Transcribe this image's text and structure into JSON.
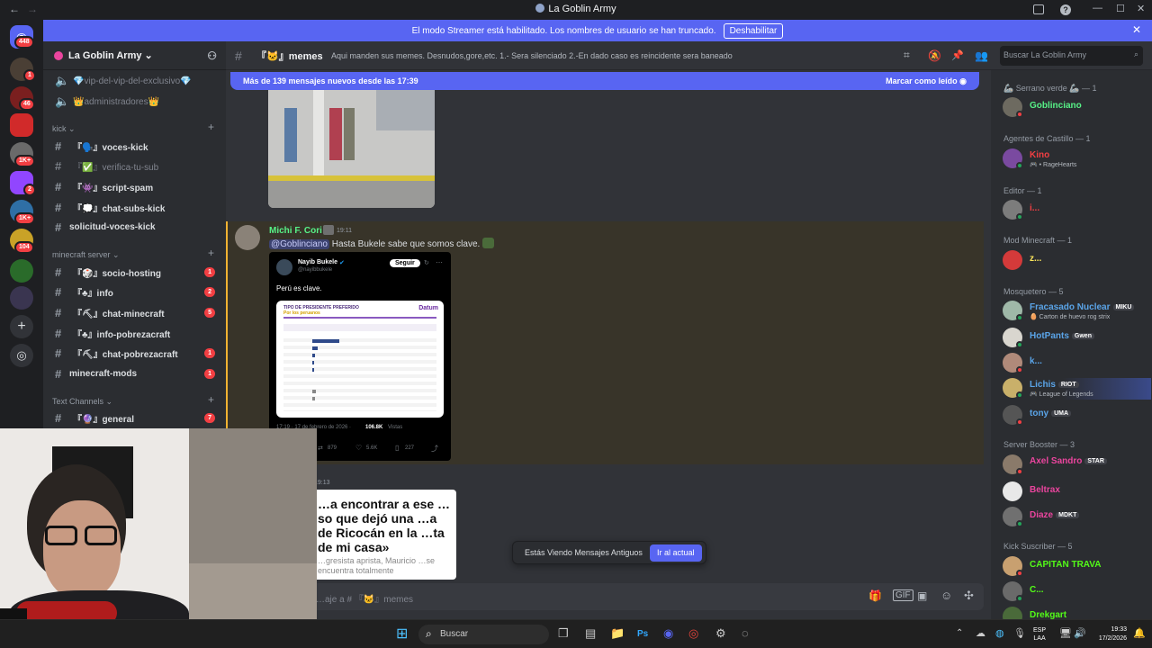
{
  "window": {
    "title": "La Goblin Army",
    "back": "←",
    "forward": "→",
    "minimize": "—",
    "maximize": "☐",
    "close": "✕"
  },
  "banner": {
    "text": "El modo Streamer está habilitado. Los nombres de usuario se han truncado.",
    "button": "Deshabilitar",
    "close": "✕"
  },
  "servers": [
    {
      "badge": "448"
    },
    {
      "badge": "1"
    },
    {
      "badge": "46"
    },
    {
      "badge": ""
    },
    {
      "badge": "1K+"
    },
    {
      "badge": "2"
    },
    {
      "badge": "1K+"
    },
    {
      "badge": "104"
    },
    {
      "badge": ""
    },
    {
      "badge": ""
    }
  ],
  "guild": {
    "name": "La Goblin Army ⌄"
  },
  "channels": {
    "top": [
      {
        "name": "💎vip-del-vip-del-exclusivo💎",
        "icon": "speaker-icon"
      },
      {
        "name": "👑administradores👑",
        "icon": "speaker-icon"
      }
    ],
    "cat_kick": "kick ⌄",
    "kick": [
      {
        "name": "『🗣️』voces-kick",
        "badge": ""
      },
      {
        "name": "『✅』verifica-tu-sub",
        "badge": ""
      },
      {
        "name": "『👾』script-spam",
        "badge": ""
      },
      {
        "name": "『💭』chat-subs-kick",
        "badge": ""
      },
      {
        "name": "solicitud-voces-kick",
        "badge": ""
      }
    ],
    "cat_mc": "minecraft server ⌄",
    "mc": [
      {
        "name": "『🎲』socio-hosting",
        "badge": "1"
      },
      {
        "name": "『♣』info",
        "badge": "2"
      },
      {
        "name": "『⛏』chat-minecraft",
        "badge": "5"
      },
      {
        "name": "『♣』info-pobrezacraft",
        "badge": ""
      },
      {
        "name": "『⛏』chat-pobrezacraft",
        "badge": "1"
      },
      {
        "name": "minecraft-mods",
        "badge": "1"
      }
    ],
    "cat_text": "Text Channels ⌄",
    "text": [
      {
        "name": "『🔮』general",
        "badge": "7"
      }
    ]
  },
  "header": {
    "channel": "『🐱』memes",
    "topic": "Aqui manden sus memes. Desnudos,gore,etc. 1.- Sera silenciado 2.-En dado caso es reincidente sera baneado",
    "search_placeholder": "Buscar La Goblin Army"
  },
  "chat": {
    "new_messages": "Más de 139 mensajes nuevos desde las 17:39",
    "mark_read": "Marcar como leído",
    "message": {
      "author": "Michi F. Cori",
      "time": "19:11",
      "mention": "@Goblinciano",
      "text": "Hasta Bukele sabe que somos clave.",
      "tweet": {
        "name": "Nayib Bukele",
        "handle": "@nayibbukele",
        "follow": "Seguir",
        "body": "Perú es clave.",
        "chart_title": "TIPO DE PRESIDENTE PREFERIDO",
        "chart_sub": "Por los peruanos",
        "brand": "Datum",
        "footer_date": "17:19 · 17 de febrero de 2026 ·",
        "views": "106.8K",
        "views_label": "Vistas",
        "replies": "879",
        "likes": "5.6K",
        "bookmarks": "227"
      }
    },
    "next_time": "19:13",
    "article": "…a encontrar a ese …so que dejó una …a de Ricocán en la …ta de mi casa»",
    "article_sub": "…gresista aprista, Mauricio …se encuentra totalmente",
    "viewing_old": "Estás Viendo Mensajes Antiguos",
    "jump": "Ir al actual",
    "composer_placeholder": "…aje a # 『🐱』memes"
  },
  "members": [
    {
      "cat": "🦾 Serrano verde 🦾 — 1",
      "items": [
        {
          "name": "Goblinciano",
          "color": "#57f287",
          "sub": "",
          "tag": ""
        }
      ]
    },
    {
      "cat": "Agentes de Castillo — 1",
      "items": [
        {
          "name": "Kino",
          "color": "#f23f43",
          "sub": "🎮 • RageHearts",
          "tag": ""
        }
      ]
    },
    {
      "cat": "Editor — 1",
      "items": [
        {
          "name": "i...",
          "color": "#f23f43",
          "sub": "",
          "tag": ""
        }
      ]
    },
    {
      "cat": "Mod Minecraft — 1",
      "items": [
        {
          "name": "z...",
          "color": "#fee75c",
          "sub": "",
          "tag": ""
        }
      ]
    },
    {
      "cat": "Mosquetero — 5",
      "items": [
        {
          "name": "Fracasado Nuclear",
          "color": "#3ba55c",
          "sub": "🥚 Carton de huevo rog strix",
          "tag": "MIKU"
        },
        {
          "name": "HotPants",
          "color": "#3ba55c",
          "sub": "",
          "tag": "Gwen"
        },
        {
          "name": "k...",
          "color": "#3ba55c",
          "sub": "",
          "tag": ""
        },
        {
          "name": "Lichis",
          "color": "#3ba55c",
          "sub": "🎮 League of Legends",
          "tag": "RIOT"
        },
        {
          "name": "tony",
          "color": "#3ba55c",
          "sub": "",
          "tag": "UMA"
        }
      ]
    },
    {
      "cat": "Server Booster — 3",
      "items": [
        {
          "name": "Axel Sandro",
          "color": "#eb459e",
          "sub": "",
          "tag": "STAR"
        },
        {
          "name": "Beltrax",
          "color": "#eb459e",
          "sub": "",
          "tag": ""
        },
        {
          "name": "Diaze",
          "color": "#eb459e",
          "sub": "",
          "tag": "MDKT"
        }
      ]
    },
    {
      "cat": "Kick Suscriber — 5",
      "items": [
        {
          "name": "CAPITAN TRAVA",
          "color": "#53fc18",
          "sub": "",
          "tag": ""
        },
        {
          "name": "C...",
          "color": "#53fc18",
          "sub": "",
          "tag": ""
        },
        {
          "name": "Drekgart",
          "color": "#53fc18",
          "sub": "",
          "tag": ""
        }
      ]
    }
  ],
  "taskbar": {
    "search": "Buscar",
    "lang": "ESP",
    "lang2": "LAA",
    "time": "19:33",
    "date": "17/2/2026"
  }
}
